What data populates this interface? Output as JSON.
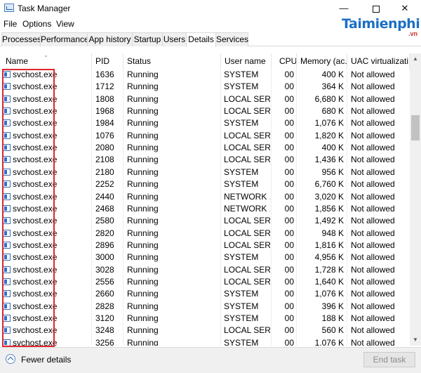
{
  "window": {
    "title": "Task Manager",
    "controls": {
      "minimize": "—",
      "close": "✕"
    }
  },
  "menu": [
    "File",
    "Options",
    "View"
  ],
  "watermark": {
    "logo": "Taimienphi",
    "suffix": ".vn"
  },
  "tabs": [
    "Processes",
    "Performance",
    "App history",
    "Startup",
    "Users",
    "Details",
    "Services"
  ],
  "active_tab": "Details",
  "columns": {
    "name": "Name",
    "pid": "PID",
    "status": "Status",
    "user": "User name",
    "cpu": "CPU",
    "memory": "Memory (ac...",
    "uac": "UAC virtualizati..."
  },
  "rows": [
    {
      "name": "svchost.exe",
      "pid": "1636",
      "status": "Running",
      "user": "SYSTEM",
      "cpu": "00",
      "mem": "400 K",
      "uac": "Not allowed"
    },
    {
      "name": "svchost.exe",
      "pid": "1712",
      "status": "Running",
      "user": "SYSTEM",
      "cpu": "00",
      "mem": "364 K",
      "uac": "Not allowed"
    },
    {
      "name": "svchost.exe",
      "pid": "1808",
      "status": "Running",
      "user": "LOCAL SER...",
      "cpu": "00",
      "mem": "6,680 K",
      "uac": "Not allowed"
    },
    {
      "name": "svchost.exe",
      "pid": "1968",
      "status": "Running",
      "user": "LOCAL SER...",
      "cpu": "00",
      "mem": "680 K",
      "uac": "Not allowed"
    },
    {
      "name": "svchost.exe",
      "pid": "1984",
      "status": "Running",
      "user": "SYSTEM",
      "cpu": "00",
      "mem": "1,076 K",
      "uac": "Not allowed"
    },
    {
      "name": "svchost.exe",
      "pid": "1076",
      "status": "Running",
      "user": "LOCAL SER...",
      "cpu": "00",
      "mem": "1,820 K",
      "uac": "Not allowed"
    },
    {
      "name": "svchost.exe",
      "pid": "2080",
      "status": "Running",
      "user": "LOCAL SER...",
      "cpu": "00",
      "mem": "400 K",
      "uac": "Not allowed"
    },
    {
      "name": "svchost.exe",
      "pid": "2108",
      "status": "Running",
      "user": "LOCAL SER...",
      "cpu": "00",
      "mem": "1,436 K",
      "uac": "Not allowed"
    },
    {
      "name": "svchost.exe",
      "pid": "2180",
      "status": "Running",
      "user": "SYSTEM",
      "cpu": "00",
      "mem": "956 K",
      "uac": "Not allowed"
    },
    {
      "name": "svchost.exe",
      "pid": "2252",
      "status": "Running",
      "user": "SYSTEM",
      "cpu": "00",
      "mem": "6,760 K",
      "uac": "Not allowed"
    },
    {
      "name": "svchost.exe",
      "pid": "2440",
      "status": "Running",
      "user": "NETWORK ...",
      "cpu": "00",
      "mem": "3,020 K",
      "uac": "Not allowed"
    },
    {
      "name": "svchost.exe",
      "pid": "2468",
      "status": "Running",
      "user": "NETWORK ...",
      "cpu": "00",
      "mem": "1,856 K",
      "uac": "Not allowed"
    },
    {
      "name": "svchost.exe",
      "pid": "2580",
      "status": "Running",
      "user": "LOCAL SER...",
      "cpu": "00",
      "mem": "1,492 K",
      "uac": "Not allowed"
    },
    {
      "name": "svchost.exe",
      "pid": "2820",
      "status": "Running",
      "user": "LOCAL SER...",
      "cpu": "00",
      "mem": "948 K",
      "uac": "Not allowed"
    },
    {
      "name": "svchost.exe",
      "pid": "2896",
      "status": "Running",
      "user": "LOCAL SER...",
      "cpu": "00",
      "mem": "1,816 K",
      "uac": "Not allowed"
    },
    {
      "name": "svchost.exe",
      "pid": "3000",
      "status": "Running",
      "user": "SYSTEM",
      "cpu": "00",
      "mem": "4,956 K",
      "uac": "Not allowed"
    },
    {
      "name": "svchost.exe",
      "pid": "3028",
      "status": "Running",
      "user": "LOCAL SER...",
      "cpu": "00",
      "mem": "1,728 K",
      "uac": "Not allowed"
    },
    {
      "name": "svchost.exe",
      "pid": "2556",
      "status": "Running",
      "user": "LOCAL SER...",
      "cpu": "00",
      "mem": "1,640 K",
      "uac": "Not allowed"
    },
    {
      "name": "svchost.exe",
      "pid": "2660",
      "status": "Running",
      "user": "SYSTEM",
      "cpu": "00",
      "mem": "1,076 K",
      "uac": "Not allowed"
    },
    {
      "name": "svchost.exe",
      "pid": "2828",
      "status": "Running",
      "user": "SYSTEM",
      "cpu": "00",
      "mem": "396 K",
      "uac": "Not allowed"
    },
    {
      "name": "svchost.exe",
      "pid": "3120",
      "status": "Running",
      "user": "SYSTEM",
      "cpu": "00",
      "mem": "188 K",
      "uac": "Not allowed"
    },
    {
      "name": "svchost.exe",
      "pid": "3248",
      "status": "Running",
      "user": "LOCAL SER...",
      "cpu": "00",
      "mem": "560 K",
      "uac": "Not allowed"
    },
    {
      "name": "svchost.exe",
      "pid": "3256",
      "status": "Running",
      "user": "SYSTEM",
      "cpu": "00",
      "mem": "1,076 K",
      "uac": "Not allowed"
    }
  ],
  "footer": {
    "fewer_details": "Fewer details",
    "end_task": "End task"
  },
  "colors": {
    "highlight": "#e0262b",
    "brand": "#1b6fc4"
  }
}
